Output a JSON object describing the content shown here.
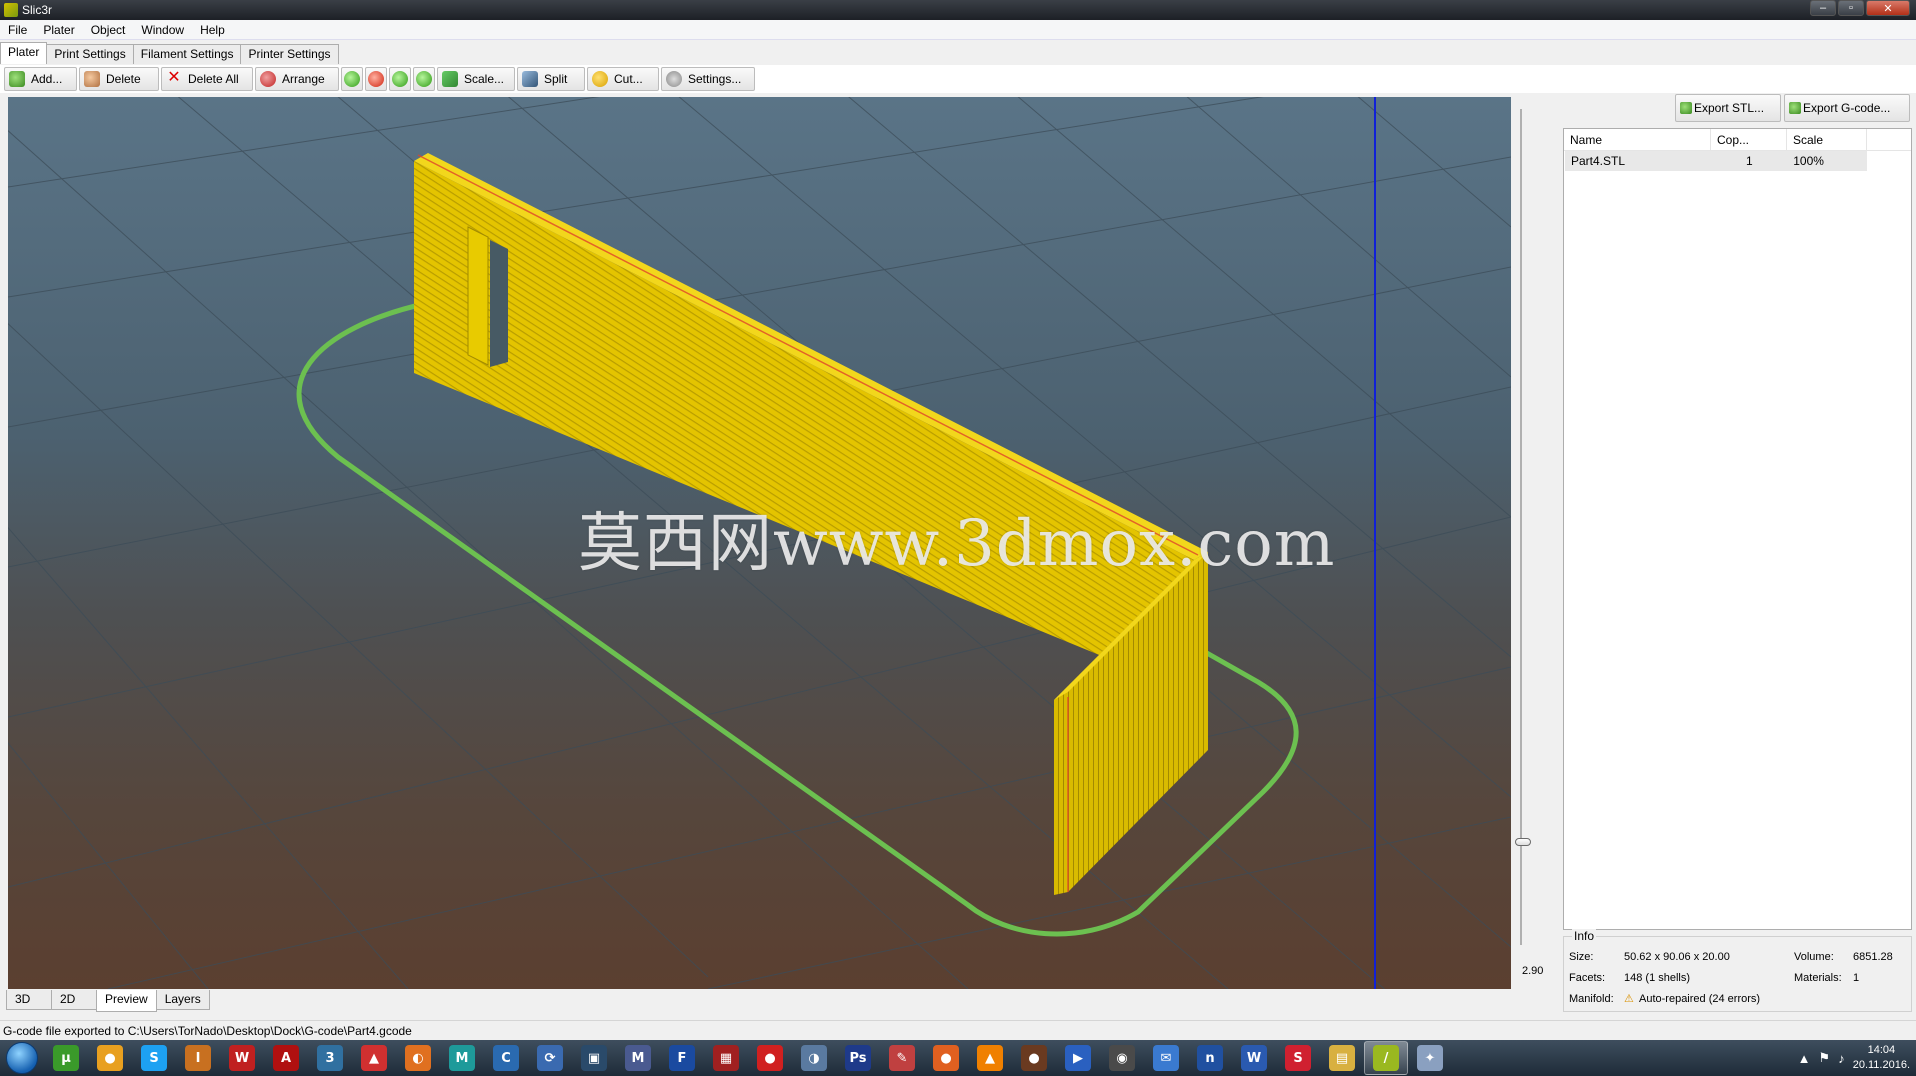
{
  "window": {
    "title": "Slic3r"
  },
  "menu": [
    "File",
    "Plater",
    "Object",
    "Window",
    "Help"
  ],
  "tabs": [
    "Plater",
    "Print Settings",
    "Filament Settings",
    "Printer Settings"
  ],
  "toolbar": {
    "add": "Add...",
    "delete": "Delete",
    "delete_all": "Delete All",
    "arrange": "Arrange",
    "scale": "Scale...",
    "split": "Split",
    "cut": "Cut...",
    "settings": "Settings..."
  },
  "viewport": {
    "watermark": "莫西网www.3dmox.com",
    "layer_height_label": "2.90"
  },
  "export": {
    "stl": "Export STL...",
    "gcode": "Export G-code..."
  },
  "object_list": {
    "columns": [
      "Name",
      "Cop...",
      "Scale"
    ],
    "rows": [
      {
        "name": "Part4.STL",
        "copies": "1",
        "scale": "100%"
      }
    ]
  },
  "info": {
    "legend": "Info",
    "size_label": "Size:",
    "size": "50.62 x 90.06 x 20.00",
    "volume_label": "Volume:",
    "volume": "6851.28",
    "facets_label": "Facets:",
    "facets": "148 (1 shells)",
    "materials_label": "Materials:",
    "materials": "1",
    "manifold_label": "Manifold:",
    "manifold": "Auto-repaired (24 errors)"
  },
  "view_tabs": [
    "3D",
    "2D",
    "Preview",
    "Layers"
  ],
  "status": "G-code file exported to C:\\Users\\TorNado\\Desktop\\Dock\\G-code\\Part4.gcode",
  "taskbar": {
    "apps": [
      "utorrent-icon",
      "chrome-icon",
      "skype-icon",
      "inventor-icon",
      "solidworks-icon",
      "autocad-icon",
      "3dsmax-icon",
      "sketchup-icon",
      "blender-icon",
      "maya-icon",
      "cura-icon",
      "repetier-icon",
      "movie-icon",
      "m-icon",
      "festo-icon",
      "printer-icon",
      "record-icon",
      "audio-icon",
      "photoshop-icon",
      "paint-icon",
      "orange-icon",
      "vlc-icon",
      "headset-icon",
      "play-icon",
      "owl-icon",
      "chat-icon",
      "netis-icon",
      "word-icon",
      "slide-icon",
      "explorer-icon",
      "slic3r-icon",
      "tools-icon"
    ],
    "time": "14:04",
    "date": "20.11.2016."
  }
}
